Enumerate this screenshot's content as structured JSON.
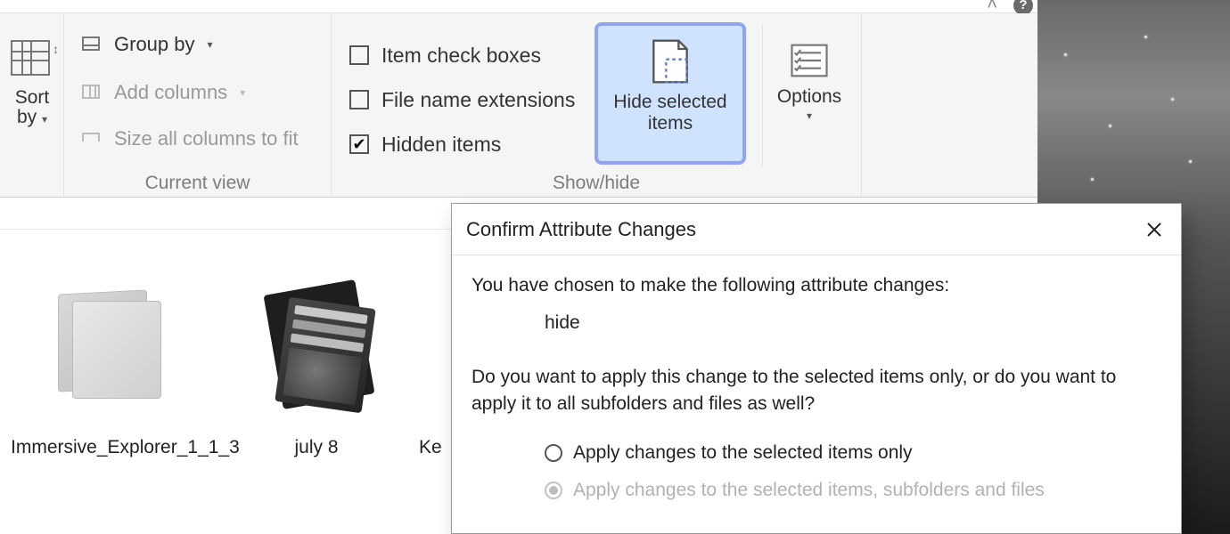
{
  "titlebar": {
    "help_tooltip": "?"
  },
  "ribbon": {
    "sort_by_label": "Sort by",
    "group_by_label": "Group by",
    "add_columns_label": "Add columns",
    "size_cols_label": "Size all columns to fit",
    "group_current_view": "Current view",
    "chk_item_check_boxes": "Item check boxes",
    "chk_file_ext": "File name extensions",
    "chk_hidden_items": "Hidden items",
    "hide_selected_label": "Hide selected items",
    "options_label": "Options",
    "group_show_hide": "Show/hide"
  },
  "files": {
    "items": [
      {
        "name": "Immersive_Explorer_1_1_3"
      },
      {
        "name": "july 8"
      },
      {
        "name": "Ke"
      }
    ]
  },
  "dialog": {
    "title": "Confirm Attribute Changes",
    "intro": "You have chosen to make the following attribute changes:",
    "attribute": "hide",
    "question": "Do you want to apply this change to the selected items only, or do you want to apply it to all subfolders and files as well?",
    "opt_selected_only": "Apply changes to the selected items only",
    "opt_recursive": "Apply changes to the selected items, subfolders and files"
  }
}
